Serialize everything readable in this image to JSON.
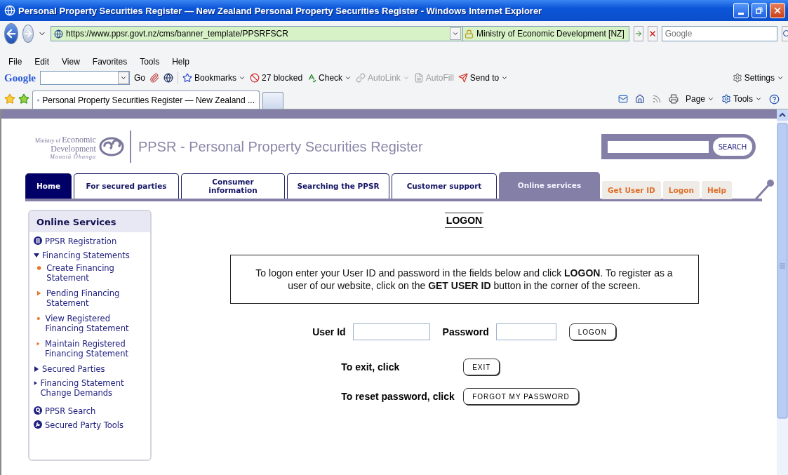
{
  "window": {
    "title": "Personal Property Securities Register — New Zealand Personal Property Securities Register - Windows Internet Explorer"
  },
  "address_bar": {
    "url": "https://www.ppsr.govt.nz/cms/banner_template/PPSRFSCR",
    "site_identity": "Ministry of Economic Development [NZ]"
  },
  "search_box": {
    "placeholder": "Google"
  },
  "menu_bar": [
    "File",
    "Edit",
    "View",
    "Favorites",
    "Tools",
    "Help"
  ],
  "google_toolbar": {
    "brand": "Google",
    "go": "Go",
    "items": [
      {
        "label": "Bookmarks",
        "kind": "bookmarks",
        "disabled": false,
        "dropdown": true
      },
      {
        "label": "27 blocked",
        "kind": "blocked",
        "disabled": false,
        "dropdown": false
      },
      {
        "label": "Check",
        "kind": "check",
        "disabled": false,
        "dropdown": true
      },
      {
        "label": "AutoLink",
        "kind": "autolink",
        "disabled": true,
        "dropdown": true
      },
      {
        "label": "AutoFill",
        "kind": "autofill",
        "disabled": true,
        "dropdown": false
      },
      {
        "label": "Send to",
        "kind": "sendto",
        "disabled": false,
        "dropdown": true
      }
    ],
    "settings": "Settings"
  },
  "browser_tab": {
    "title": "Personal Property Securities Register — New Zealand ..."
  },
  "command_bar": [
    "Page",
    "Tools"
  ],
  "page": {
    "logo": {
      "small": "Ministry of",
      "line1": "Economic",
      "line2": "Development",
      "tagline": "Manatū Ōhanga"
    },
    "site_title": "PPSR - Personal Property Securities Register",
    "search_button": "SEARCH",
    "nav_tabs": [
      {
        "label": "Home",
        "kind": "home",
        "selected": false
      },
      {
        "label": "For secured parties",
        "kind": "section",
        "selected": false
      },
      {
        "label": "Consumer information",
        "kind": "section",
        "selected": false
      },
      {
        "label": "Searching the PPSR",
        "kind": "section",
        "selected": false
      },
      {
        "label": "Customer support",
        "kind": "section",
        "selected": false
      },
      {
        "label": "Online services",
        "kind": "section",
        "selected": true
      }
    ],
    "utility_links": [
      "Get User ID",
      "Logon",
      "Help"
    ],
    "sidebar": {
      "title": "Online Services",
      "items": [
        {
          "label": "PPSR Registration",
          "kind": "register"
        },
        {
          "label": "Financing Statements",
          "kind": "group",
          "expanded": true,
          "children": [
            {
              "label": "Create Financing Statement",
              "kind": "dot"
            },
            {
              "label": "Pending Financing Statement",
              "kind": "arrow"
            },
            {
              "label": "View Registered Financing Statement",
              "kind": "dot"
            },
            {
              "label": "Maintain Registered Financing Statement",
              "kind": "arrow"
            }
          ]
        },
        {
          "label": "Secured Parties",
          "kind": "group",
          "expanded": false
        },
        {
          "label": "Financing Statement Change Demands",
          "kind": "group",
          "expanded": false
        },
        {
          "label": "PPSR Search",
          "kind": "search"
        },
        {
          "label": "Secured Party Tools",
          "kind": "tools"
        }
      ]
    },
    "logon": {
      "heading": "LOGON",
      "instructions": "To logon enter your User ID and password in the fields below and click **LOGON**. To register as a user of our website, click on the **GET USER ID** button in the corner of the screen.",
      "user_id_label": "User Id",
      "password_label": "Password",
      "logon_button": "LOGON",
      "actions": [
        {
          "label": "To exit, click",
          "button": "EXIT"
        },
        {
          "label": "To reset password, click",
          "button": "FORGOT MY PASSWORD"
        }
      ]
    }
  }
}
